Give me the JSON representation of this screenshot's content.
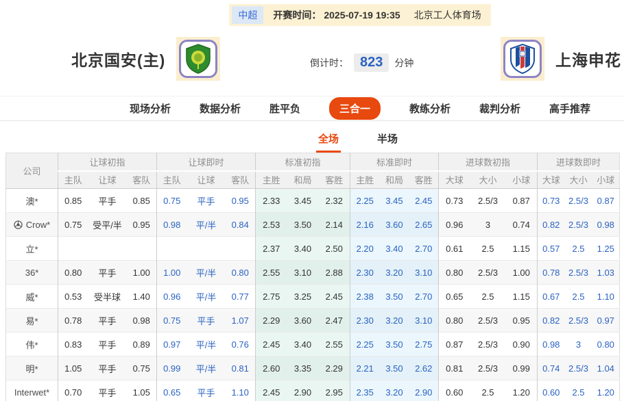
{
  "top_bar": {
    "league": "中超",
    "kickoff_label": "开赛时间：",
    "kickoff_time": "2025-07-19 19:35",
    "venue": "北京工人体育场"
  },
  "header": {
    "home_team": "北京国安(主)",
    "away_team": "上海申花",
    "home_logo_icon": "beijing-guoan-crest-icon",
    "away_logo_icon": "shanghai-shenhua-crest-icon",
    "countdown_label": "倒计时：",
    "countdown_value": "823",
    "countdown_unit": "分钟"
  },
  "nav": {
    "tabs": [
      {
        "label": "现场分析",
        "active": false
      },
      {
        "label": "数据分析",
        "active": false
      },
      {
        "label": "胜平负",
        "active": false
      },
      {
        "label": "三合一",
        "active": true
      },
      {
        "label": "教练分析",
        "active": false
      },
      {
        "label": "裁判分析",
        "active": false
      },
      {
        "label": "高手推荐",
        "active": false
      }
    ]
  },
  "subtabs": [
    {
      "label": "全场",
      "active": true
    },
    {
      "label": "半场",
      "active": false
    }
  ],
  "table": {
    "company_header": "公司",
    "groups": [
      {
        "title": "让球初指",
        "cols": [
          "主队",
          "让球",
          "客队"
        ],
        "live": false
      },
      {
        "title": "让球即时",
        "cols": [
          "主队",
          "让球",
          "客队"
        ],
        "live": true
      },
      {
        "title": "标准初指",
        "cols": [
          "主胜",
          "和局",
          "客胜"
        ],
        "live": false
      },
      {
        "title": "标准即时",
        "cols": [
          "主胜",
          "和局",
          "客胜"
        ],
        "live": true
      },
      {
        "title": "进球数初指",
        "cols": [
          "大球",
          "大小",
          "小球"
        ],
        "live": false
      },
      {
        "title": "进球数即时",
        "cols": [
          "大球",
          "大小",
          "小球"
        ],
        "live": true
      }
    ],
    "rows": [
      {
        "company": "澳*",
        "icon": null,
        "cells": [
          [
            "0.85",
            "平手",
            "0.85"
          ],
          [
            "0.75",
            "平手",
            "0.95"
          ],
          [
            "2.33",
            "3.45",
            "2.32"
          ],
          [
            "2.25",
            "3.45",
            "2.45"
          ],
          [
            "0.73",
            "2.5/3",
            "0.87"
          ],
          [
            "0.73",
            "2.5/3",
            "0.87"
          ]
        ]
      },
      {
        "company": "Crow*",
        "icon": "soccer-ball-icon",
        "cells": [
          [
            "0.75",
            "受平/半",
            "0.95"
          ],
          [
            "0.98",
            "平/半",
            "0.84"
          ],
          [
            "2.53",
            "3.50",
            "2.14"
          ],
          [
            "2.16",
            "3.60",
            "2.65"
          ],
          [
            "0.96",
            "3",
            "0.74"
          ],
          [
            "0.82",
            "2.5/3",
            "0.98"
          ]
        ]
      },
      {
        "company": "立*",
        "icon": null,
        "cells": [
          [
            "",
            "",
            ""
          ],
          [
            "",
            "",
            ""
          ],
          [
            "2.37",
            "3.40",
            "2.50"
          ],
          [
            "2.20",
            "3.40",
            "2.70"
          ],
          [
            "0.61",
            "2.5",
            "1.15"
          ],
          [
            "0.57",
            "2.5",
            "1.25"
          ]
        ]
      },
      {
        "company": "36*",
        "icon": null,
        "cells": [
          [
            "0.80",
            "平手",
            "1.00"
          ],
          [
            "1.00",
            "平/半",
            "0.80"
          ],
          [
            "2.55",
            "3.10",
            "2.88"
          ],
          [
            "2.30",
            "3.20",
            "3.10"
          ],
          [
            "0.80",
            "2.5/3",
            "1.00"
          ],
          [
            "0.78",
            "2.5/3",
            "1.03"
          ]
        ]
      },
      {
        "company": "威*",
        "icon": null,
        "cells": [
          [
            "0.53",
            "受半球",
            "1.40"
          ],
          [
            "0.96",
            "平/半",
            "0.77"
          ],
          [
            "2.75",
            "3.25",
            "2.45"
          ],
          [
            "2.38",
            "3.50",
            "2.70"
          ],
          [
            "0.65",
            "2.5",
            "1.15"
          ],
          [
            "0.67",
            "2.5",
            "1.10"
          ]
        ]
      },
      {
        "company": "易*",
        "icon": null,
        "cells": [
          [
            "0.78",
            "平手",
            "0.98"
          ],
          [
            "0.75",
            "平手",
            "1.07"
          ],
          [
            "2.29",
            "3.60",
            "2.47"
          ],
          [
            "2.30",
            "3.20",
            "3.10"
          ],
          [
            "0.80",
            "2.5/3",
            "0.95"
          ],
          [
            "0.82",
            "2.5/3",
            "0.97"
          ]
        ]
      },
      {
        "company": "伟*",
        "icon": null,
        "cells": [
          [
            "0.83",
            "平手",
            "0.89"
          ],
          [
            "0.97",
            "平/半",
            "0.76"
          ],
          [
            "2.45",
            "3.40",
            "2.55"
          ],
          [
            "2.25",
            "3.50",
            "2.75"
          ],
          [
            "0.87",
            "2.5/3",
            "0.90"
          ],
          [
            "0.98",
            "3",
            "0.80"
          ]
        ]
      },
      {
        "company": "明*",
        "icon": null,
        "cells": [
          [
            "1.05",
            "平手",
            "0.75"
          ],
          [
            "0.99",
            "平/半",
            "0.81"
          ],
          [
            "2.60",
            "3.35",
            "2.29"
          ],
          [
            "2.21",
            "3.50",
            "2.62"
          ],
          [
            "0.81",
            "2.5/3",
            "0.99"
          ],
          [
            "0.74",
            "2.5/3",
            "1.04"
          ]
        ]
      },
      {
        "company": "Interwet*",
        "icon": null,
        "cells": [
          [
            "0.70",
            "平手",
            "1.05"
          ],
          [
            "0.65",
            "平手",
            "1.10"
          ],
          [
            "2.45",
            "2.90",
            "2.95"
          ],
          [
            "2.35",
            "3.20",
            "2.90"
          ],
          [
            "0.60",
            "2.5",
            "1.20"
          ],
          [
            "0.60",
            "2.5",
            "1.20"
          ]
        ]
      }
    ]
  },
  "colors": {
    "accent_orange": "#e8490f",
    "live_blue": "#2a62c2",
    "bar_cream": "#fcf1d3",
    "league_badge_bg": "#dde8f7",
    "league_badge_text": "#3a6cd0",
    "header_gray_bg": "#f1f1f1",
    "tint_standard_initial": "#e9f6f2",
    "tint_standard_live": "#ebf7fd"
  }
}
